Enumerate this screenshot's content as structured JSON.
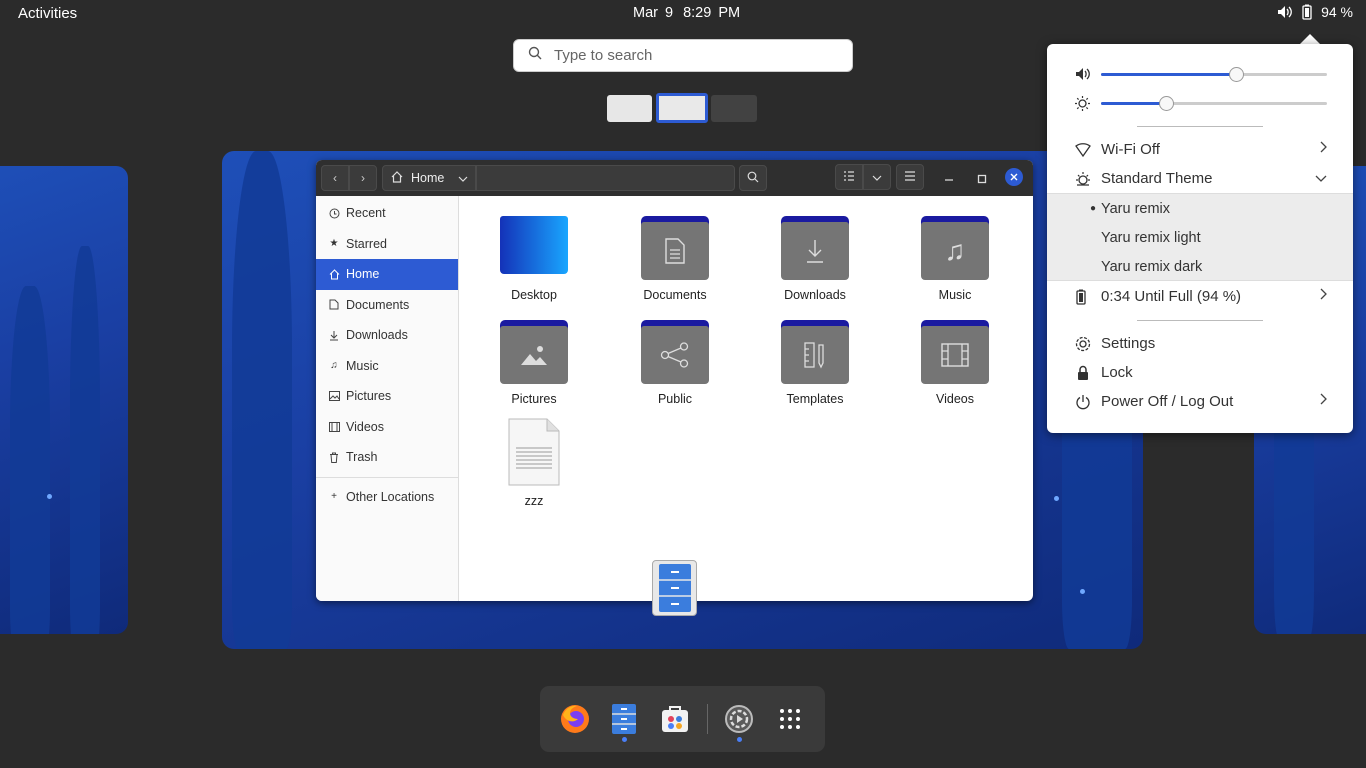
{
  "topbar": {
    "activities_label": "Activities",
    "date": "Mar 9",
    "time": "8:29 PM",
    "battery_percent": "94 %",
    "icons": [
      "volume-icon",
      "battery-icon"
    ]
  },
  "search": {
    "placeholder": "Type to search"
  },
  "files": {
    "location": "Home",
    "sidebar": [
      {
        "label": "Recent",
        "icon": "clock-icon"
      },
      {
        "label": "Starred",
        "icon": "star-icon"
      },
      {
        "label": "Home",
        "icon": "home-icon",
        "active": true
      },
      {
        "label": "Documents",
        "icon": "document-icon"
      },
      {
        "label": "Downloads",
        "icon": "download-icon"
      },
      {
        "label": "Music",
        "icon": "music-icon"
      },
      {
        "label": "Pictures",
        "icon": "pictures-icon"
      },
      {
        "label": "Videos",
        "icon": "video-icon"
      },
      {
        "label": "Trash",
        "icon": "trash-icon"
      }
    ],
    "other_locations": "Other Locations",
    "items": [
      {
        "label": "Desktop"
      },
      {
        "label": "Documents"
      },
      {
        "label": "Downloads"
      },
      {
        "label": "Music"
      },
      {
        "label": "Pictures"
      },
      {
        "label": "Public"
      },
      {
        "label": "Templates"
      },
      {
        "label": "Videos"
      },
      {
        "label": "zzz"
      }
    ]
  },
  "dock": {
    "apps": [
      "firefox-icon",
      "files-icon",
      "software-icon",
      "settings-icon",
      "app-grid-icon"
    ]
  },
  "menu": {
    "volume_level": 0.6,
    "brightness_level": 0.29,
    "wifi": "Wi-Fi Off",
    "theme": "Standard Theme",
    "themes": [
      "Yaru remix",
      "Yaru remix light",
      "Yaru remix dark"
    ],
    "battery": "0:34 Until Full (94 %)",
    "settings": "Settings",
    "lock": "Lock",
    "power": "Power Off / Log Out"
  },
  "colors": {
    "accent": "#2d5bd3",
    "panel": "#2b2b2b",
    "dock": "#3a3a3a"
  }
}
